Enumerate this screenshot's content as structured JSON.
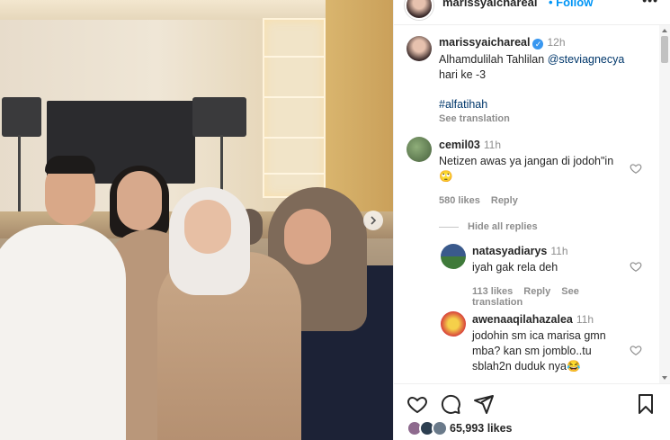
{
  "header": {
    "username": "marissyaichareal",
    "follow_label": "• Follow",
    "more_label": "•••"
  },
  "caption": {
    "username": "marissyaichareal",
    "time": "12h",
    "text_before": "Alhamdulilah Tahlilan ",
    "mention": "@steviagnecya",
    "text_after": "hari ke -3",
    "hashtag": "#alfatihah",
    "see_translation": "See translation"
  },
  "comments": [
    {
      "username": "cemil03",
      "time": "11h",
      "text": "Netizen awas ya jangan di jodoh\"in 🙄",
      "likes": "580 likes",
      "reply": "Reply",
      "hide_replies": "Hide all replies"
    }
  ],
  "replies": [
    {
      "username": "natasyadiarys",
      "time": "11h",
      "text": "iyah gak rela deh",
      "likes": "113 likes",
      "reply": "Reply",
      "see_translation": "See translation"
    },
    {
      "username": "awenaaqilahazalea",
      "time": "11h",
      "text_line1": "jodohin sm ica marisa gmn",
      "text_line2": "mba? kan sm jomblo..tu",
      "text_line3": "sblah2n duduk nya😂"
    }
  ],
  "footer": {
    "likes": "65,993 likes"
  },
  "icons": {
    "like": "heart-icon",
    "comment": "comment-icon",
    "share": "share-icon",
    "save": "bookmark-icon",
    "next": "chevron-right-icon"
  },
  "colors": {
    "accent": "#0095f6",
    "verified": "#3897f0",
    "mention": "#00376b",
    "muted": "#8e8e8e"
  }
}
